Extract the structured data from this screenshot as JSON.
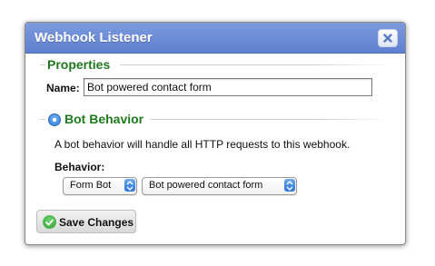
{
  "dialog": {
    "title": "Webhook Listener",
    "close_icon": "close-icon"
  },
  "properties": {
    "heading": "Properties",
    "name_label": "Name:",
    "name_value": "Bot powered contact form"
  },
  "bot_behavior": {
    "heading": "Bot Behavior",
    "description": "A bot behavior will handle all HTTP requests to this webhook.",
    "behavior_label": "Behavior:",
    "type_select": {
      "selected": "Form Bot"
    },
    "bot_select": {
      "selected": "Bot powered contact form"
    }
  },
  "footer": {
    "save_label": "Save Changes",
    "save_icon": "check-icon"
  },
  "colors": {
    "titlebar": "#6a89d6",
    "section_heading": "#1f7a1f",
    "select_arrow": "#2d74d6"
  }
}
